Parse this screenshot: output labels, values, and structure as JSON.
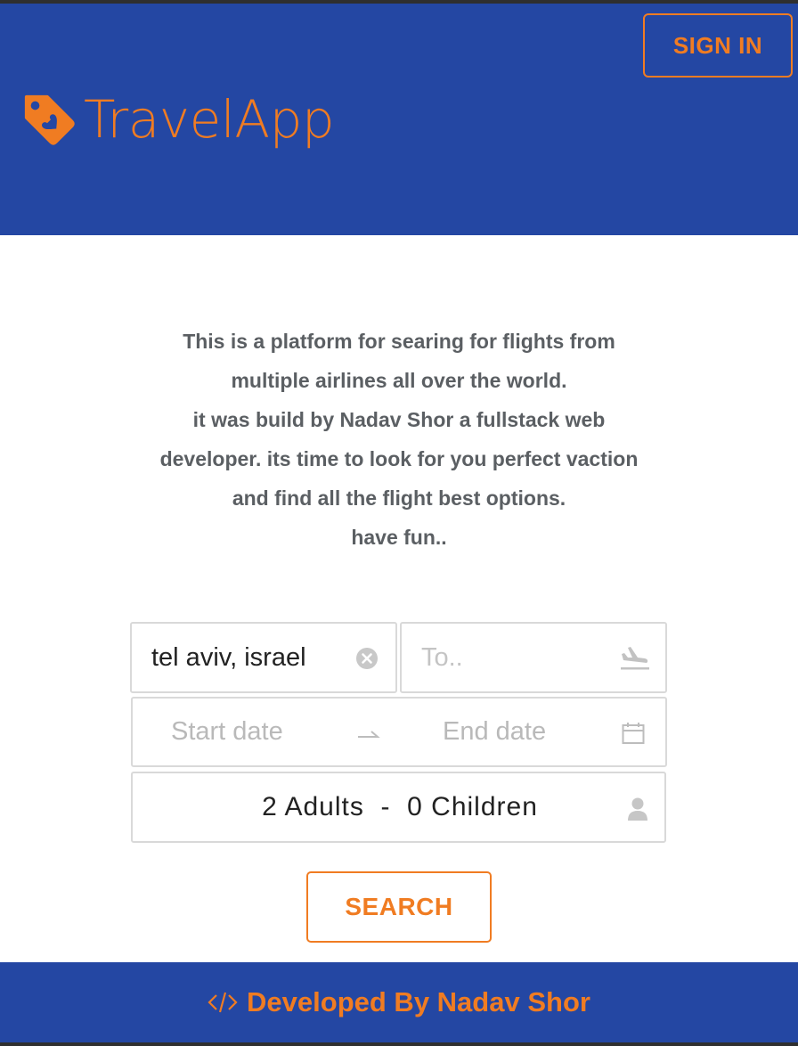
{
  "header": {
    "sign_in_label": "SIGN IN",
    "brand_name": "TravelApp",
    "brand_icon": "heart-tag-icon"
  },
  "intro": {
    "lines": [
      "This is a platform for searing for flights from",
      "multiple airlines all over the world.",
      "it was build by Nadav Shor a fullstack web",
      "developer. its time to look for you perfect vaction",
      "and find all the flight best options.",
      "have fun.."
    ]
  },
  "search_form": {
    "from_value": "tel aviv, israel",
    "to_placeholder": "To..",
    "start_date_placeholder": "Start date",
    "end_date_placeholder": "End date",
    "passengers": "2 Adults  -  0 Children",
    "search_label": "SEARCH"
  },
  "footer": {
    "text": "Developed By Nadav Shor",
    "icon": "code-icon"
  },
  "colors": {
    "primary_blue": "#2447a3",
    "accent_orange": "#f07c22",
    "text_gray": "#5b5f63",
    "border_gray": "#d9d9d9"
  }
}
